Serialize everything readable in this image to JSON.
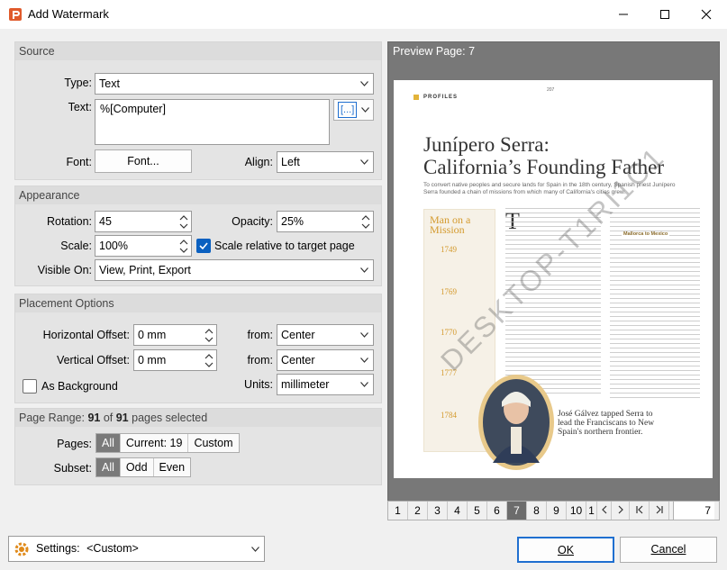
{
  "window": {
    "title": "Add Watermark",
    "controls": {
      "minimize": "minimize-icon",
      "maximize": "maximize-icon",
      "close": "close-icon"
    }
  },
  "source": {
    "header": "Source",
    "type_label": "Type:",
    "type_value": "Text",
    "text_label": "Text:",
    "text_value": "%[Computer]",
    "macro_button": "[...]",
    "font_label": "Font:",
    "font_button": "Font...",
    "align_label": "Align:",
    "align_value": "Left"
  },
  "appearance": {
    "header": "Appearance",
    "rotation_label": "Rotation:",
    "rotation_value": "45",
    "opacity_label": "Opacity:",
    "opacity_value": "25%",
    "scale_label": "Scale:",
    "scale_value": "100%",
    "scale_relative_label": "Scale relative to target page",
    "scale_relative_checked": true,
    "visible_label": "Visible On:",
    "visible_value": "View, Print, Export"
  },
  "placement": {
    "header": "Placement Options",
    "h_offset_label": "Horizontal Offset:",
    "h_offset_value": "0 mm",
    "v_offset_label": "Vertical Offset:",
    "v_offset_value": "0 mm",
    "from_label": "from:",
    "h_from_value": "Center",
    "v_from_value": "Center",
    "as_background_label": "As Background",
    "as_background_checked": false,
    "units_label": "Units:",
    "units_value": "millimeter"
  },
  "page_range": {
    "header_prefix": "Page Range: ",
    "selected_count": "91",
    "of_text": " of ",
    "total_count": "91",
    "suffix": " pages selected",
    "pages_label": "Pages:",
    "pages_options": [
      "All",
      "Current: 19",
      "Custom"
    ],
    "subset_label": "Subset:",
    "subset_options": [
      "All",
      "Odd",
      "Even"
    ]
  },
  "preview": {
    "header": "Preview Page: 7",
    "watermark_text": "DESKTOP-T1RI1C1",
    "page_numbers": [
      "1",
      "2",
      "3",
      "4",
      "5",
      "6",
      "7",
      "8",
      "9",
      "10",
      "1"
    ],
    "current_page": "7",
    "page_input_value": "7",
    "doc": {
      "section": "PROFILES",
      "folio": "207",
      "headline_1": "Junípero Serra:",
      "headline_2": "California’s Founding Father",
      "deck": "To convert native peoples and secure lands for Spain in the 18th century, Spanish priest Junípero Serra founded a chain of missions from which many of California's cities grew.",
      "sidebar_title": "Man on a Mission",
      "sidebar_years": [
        "1749",
        "1769",
        "1770",
        "1777",
        "1784"
      ],
      "dropcap": "T",
      "subhead": "Mallorca to Mexico",
      "caption": "José Gálvez tapped Serra to lead the Franciscans to New Spain's northern frontier."
    }
  },
  "footer": {
    "settings_label": "Settings:",
    "settings_value": "<Custom>",
    "ok_button": "OK",
    "cancel_button": "Cancel"
  }
}
